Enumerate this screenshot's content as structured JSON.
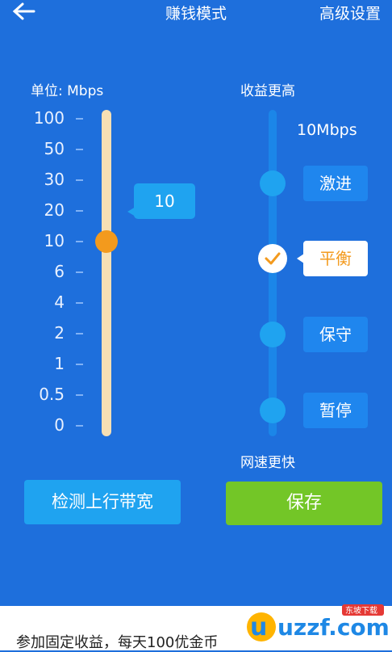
{
  "header": {
    "title": "赚钱模式",
    "advanced_label": "高级设置"
  },
  "bandwidth": {
    "unit_label": "单位: Mbps",
    "ticks": [
      "100",
      "50",
      "30",
      "20",
      "10",
      "6",
      "4",
      "2",
      "1",
      "0.5",
      "0"
    ],
    "selected_value": "10",
    "detect_button": "检测上行带宽"
  },
  "modes": {
    "top_label": "收益更高",
    "bottom_label": "网速更快",
    "speed_value": "10Mbps",
    "items": [
      {
        "label": "激进",
        "selected": false
      },
      {
        "label": "平衡",
        "selected": true
      },
      {
        "label": "保守",
        "selected": false
      },
      {
        "label": "暂停",
        "selected": false
      }
    ],
    "save_button": "保存"
  },
  "ad": {
    "text": "参加固定收益，每天100优金币",
    "logo_text": "uzzf.com",
    "logo_sub": "东坡下载"
  },
  "colors": {
    "background": "#1e6fdc",
    "knob": "#f39a1d",
    "save": "#73c627",
    "button": "#1fa3f0"
  }
}
